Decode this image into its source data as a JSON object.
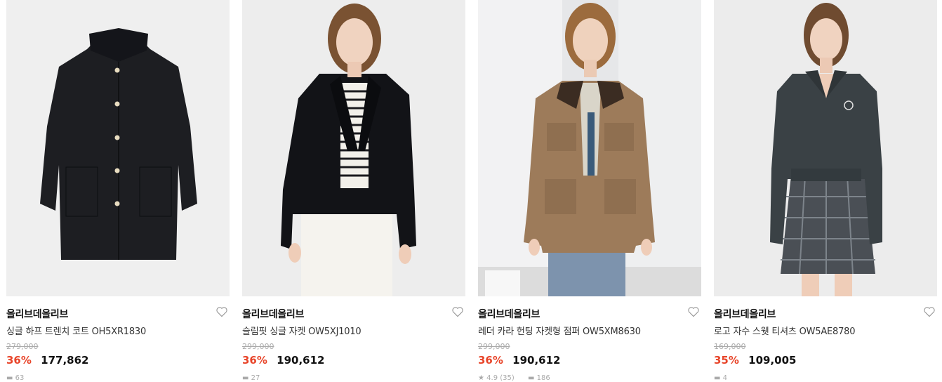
{
  "products": [
    {
      "brand": "올리브데올리브",
      "name": "싱글 하프 트렌치 코트 OH5XR1830",
      "original_price": "279,000",
      "discount_rate": "36%",
      "sale_price": "177,862",
      "review_count": "63",
      "heart_icon": "heart-outline-icon",
      "image": "product-only black coat on light grey background"
    },
    {
      "brand": "올리브데올리브",
      "name": "슬림핏 싱글 자켓 OW5XJ1010",
      "original_price": "299,000",
      "discount_rate": "36%",
      "sale_price": "190,612",
      "review_count": "27",
      "heart_icon": "heart-outline-icon",
      "image": "model in black blazer and striped top"
    },
    {
      "brand": "올리브데올리브",
      "name": "레더 카라 헌팅 자켓형 점퍼 OW5XM8630",
      "original_price": "299,000",
      "discount_rate": "36%",
      "sale_price": "190,612",
      "rating": "4.9 (35)",
      "review_count": "186",
      "heart_icon": "heart-outline-icon",
      "image": "model in beige hunting jacket and jeans"
    },
    {
      "brand": "올리브데올리브",
      "name": "로고 자수 스웻 티셔츠 OW5AE8780",
      "original_price": "169,000",
      "discount_rate": "35%",
      "sale_price": "109,005",
      "review_count": "4",
      "heart_icon": "heart-outline-icon",
      "image": "model in charcoal sweatshirt and plaid skirt"
    }
  ],
  "colors": {
    "discount": "#e8452a",
    "muted": "#aaaaaa"
  }
}
